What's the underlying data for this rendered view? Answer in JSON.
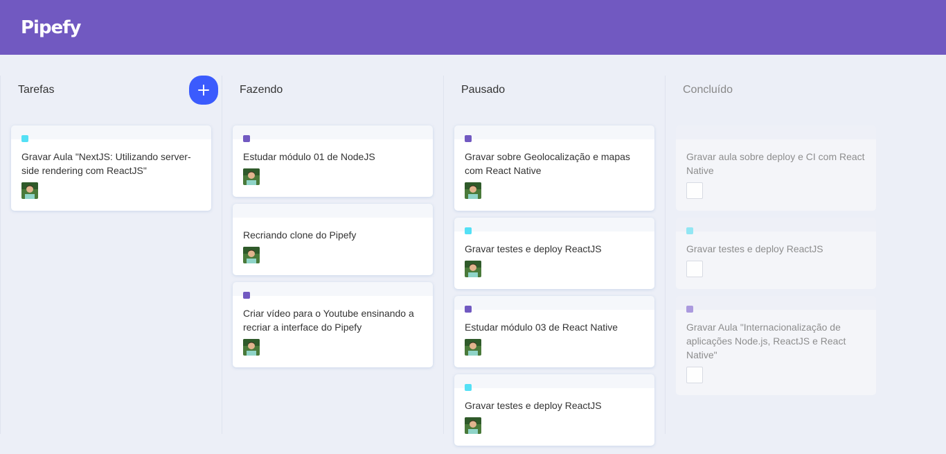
{
  "app": {
    "logo": "Pipefy"
  },
  "colors": {
    "header": "#7159c1",
    "add_button": "#3b5bfd",
    "label_purple": "#7159c1",
    "label_cyan": "#54e0f5",
    "label_cyan_light": "#8ee6f3",
    "label_lavender": "#a896dd"
  },
  "lists": [
    {
      "title": "Tarefas",
      "creatable": true,
      "cards": [
        {
          "label": "cyan",
          "text": "Gravar Aula \"NextJS: Utilizando server-side rendering com ReactJS\"",
          "avatar": "user-avatar"
        }
      ]
    },
    {
      "title": "Fazendo",
      "cards": [
        {
          "label": "purple",
          "text": "Estudar módulo 01 de NodeJS",
          "avatar": "user-avatar"
        },
        {
          "label": "none",
          "text": "Recriando clone do Pipefy",
          "avatar": "user-avatar"
        },
        {
          "label": "purple",
          "text": "Criar vídeo para o Youtube ensinando a recriar a interface do Pipefy",
          "avatar": "user-avatar"
        }
      ]
    },
    {
      "title": "Pausado",
      "cards": [
        {
          "label": "purple",
          "text": "Gravar sobre Geolocalização e mapas com React Native",
          "avatar": "user-avatar"
        },
        {
          "label": "cyan",
          "text": "Gravar testes e deploy ReactJS",
          "avatar": "user-avatar"
        },
        {
          "label": "purple",
          "text": "Estudar módulo 03 de React Native",
          "avatar": "user-avatar"
        },
        {
          "label": "cyan",
          "text": "Gravar testes e deploy ReactJS",
          "avatar": "user-avatar"
        }
      ]
    },
    {
      "title": "Concluído",
      "done": true,
      "cards": [
        {
          "label": "none",
          "text": "Gravar aula sobre deploy e CI com React Native",
          "checkbox": "unchecked"
        },
        {
          "label": "cyan_light",
          "text": "Gravar testes e deploy ReactJS",
          "checkbox": "unchecked"
        },
        {
          "label": "lavender",
          "text": "Gravar Aula \"Internacionalização de aplicações Node.js, ReactJS e React Native\"",
          "checkbox": "unchecked"
        }
      ]
    }
  ]
}
